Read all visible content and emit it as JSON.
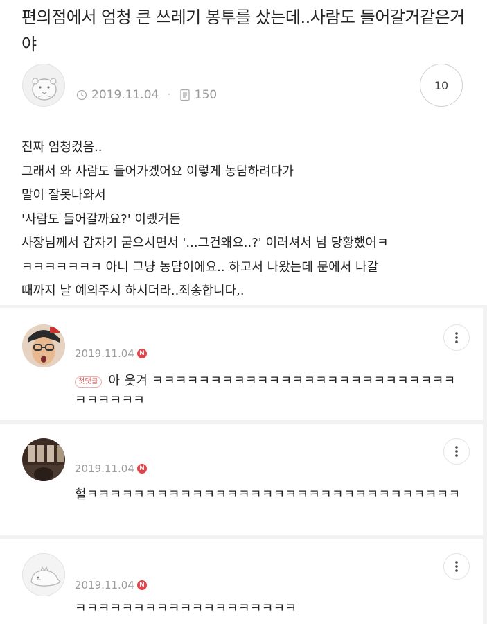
{
  "post": {
    "title": "편의점에서 엄청 큰 쓰레기 봉투를 샀는데..사람도 들어갈거같은거야",
    "date": "2019.11.04",
    "views": "150",
    "comment_count": "10",
    "body_lines": [
      "진짜 엄청컸음..",
      "그래서 와 사람도 들어가겠어요 이렇게 농담하려다가",
      "말이 잘못나와서",
      "'사람도 들어갈까요?' 이랬거든",
      "사장님께서 갑자기 굳으시면서 '...그건왜요..?' 이러셔서 넘 당황했어ㅋ",
      "ㅋㅋㅋㅋㅋㅋㅋ 아니 그냥 농담이에요.. 하고서 나왔는데 문에서 나갈",
      "때까지 날 예의주시 하시더라..죄송합니다,."
    ]
  },
  "comments": [
    {
      "date": "2019.11.04",
      "badge": "N",
      "first_label": "첫댓글",
      "text": "아     웃겨 ㅋㅋㅋㅋㅋㅋㅋㅋㅋㅋㅋㅋㅋㅋㅋㅋㅋㅋㅋㅋㅋㅋㅋㅋㅋㅋㅋㅋㅋㅋㅋㅋ"
    },
    {
      "date": "2019.11.04",
      "badge": "N",
      "text": "헐ㅋㅋㅋㅋㅋㅋㅋㅋㅋㅋㅋㅋㅋㅋㅋㅋㅋㅋㅋㅋㅋㅋㅋㅋㅋㅋㅋㅋㅋㅋㅋㅋ"
    },
    {
      "date": "2019.11.04",
      "badge": "N",
      "text": "ㅋㅋㅋㅋㅋㅋㅋㅋㅋㅋㅋㅋㅋㅋㅋㅋㅋㅋㅋ"
    }
  ],
  "icons": {
    "date": "clock-icon",
    "views": "document-icon",
    "more": "more-vertical-icon"
  },
  "colors": {
    "badge": "#e0454b",
    "first_comment_label": "#e25a5a",
    "meta_text": "#9a9a9a"
  }
}
